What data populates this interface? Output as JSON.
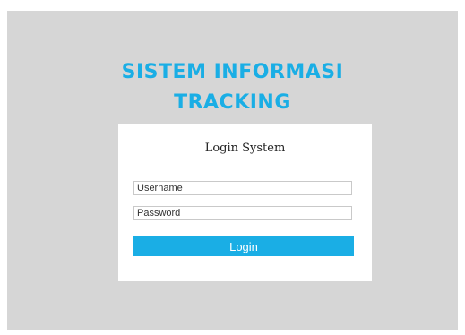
{
  "header": {
    "title_line1": "SISTEM INFORMASI",
    "title_line2": "TRACKING"
  },
  "login": {
    "heading": "Login System",
    "username": {
      "placeholder": "Username",
      "value": ""
    },
    "password": {
      "placeholder": "Password",
      "value": ""
    },
    "submit_label": "Login"
  },
  "colors": {
    "accent": "#1aaee5",
    "background": "#d6d6d6",
    "card": "#ffffff"
  }
}
